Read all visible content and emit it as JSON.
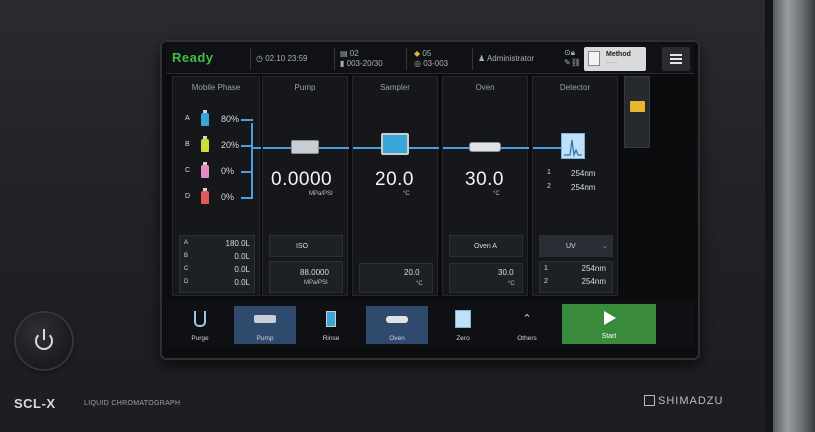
{
  "device": {
    "model": "SCL-X",
    "subtitle": "LIQUID CHROMATOGRAPH",
    "maker": "SHIMADZU",
    "power_button_icon": "power-icon"
  },
  "topbar": {
    "status": "Ready",
    "datetime": "02.10 23:59",
    "tray_top": "02",
    "tray_bottom": "003-20/30",
    "vial_top": "05",
    "vial_bottom": "03-003",
    "user": "Administrator",
    "method_label": "Method",
    "method_sub": "- - - -"
  },
  "columns": {
    "mobile_phase": {
      "title": "Mobile Phase",
      "lines": [
        {
          "letter": "A",
          "value": "80%",
          "color": "#3aa6d8"
        },
        {
          "letter": "B",
          "value": "20%",
          "color": "#cddc39"
        },
        {
          "letter": "C",
          "value": "0%",
          "color": "#e48bc2"
        },
        {
          "letter": "D",
          "value": "0%",
          "color": "#e05a5a"
        }
      ],
      "lower": [
        {
          "letter": "A",
          "value": "180.0L"
        },
        {
          "letter": "B",
          "value": "0.0L"
        },
        {
          "letter": "C",
          "value": "0.0L"
        },
        {
          "letter": "D",
          "value": "0.0L"
        }
      ]
    },
    "pump": {
      "title": "Pump",
      "value": "0.0000",
      "unit": "MPa/PSI",
      "mode": "ISO",
      "lower_value": "88.0000",
      "lower_unit": "MPa/PSI"
    },
    "sampler": {
      "title": "Sampler",
      "value": "20.0",
      "unit": "°C",
      "lower_value": "20.0",
      "lower_unit": "°C"
    },
    "oven": {
      "title": "Oven",
      "value": "30.0",
      "unit": "°C",
      "mode": "Oven A",
      "lower_value": "30.0",
      "lower_unit": "°C"
    },
    "detector": {
      "title": "Detector",
      "ch": [
        {
          "n": "1",
          "value": "254nm"
        },
        {
          "n": "2",
          "value": "254nm"
        }
      ],
      "mode": "UV",
      "lower": [
        {
          "n": "1",
          "value": "254nm"
        },
        {
          "n": "2",
          "value": "254nm"
        }
      ]
    }
  },
  "navbar": {
    "items": [
      {
        "label": "Purge",
        "icon": "purge-icon"
      },
      {
        "label": "Pump",
        "icon": "pump-icon"
      },
      {
        "label": "Rinse",
        "icon": "rinse-icon"
      },
      {
        "label": "Oven",
        "icon": "oven-icon"
      },
      {
        "label": "Zero",
        "icon": "zero-icon"
      },
      {
        "label": "Others",
        "icon": "chevron-up-icon"
      }
    ],
    "start_label": "Start"
  },
  "colors": {
    "ready": "#3fbf4a",
    "pipe": "#4aa0e0",
    "start": "#3a8a3b",
    "active_nav": "#2f4a6d"
  }
}
